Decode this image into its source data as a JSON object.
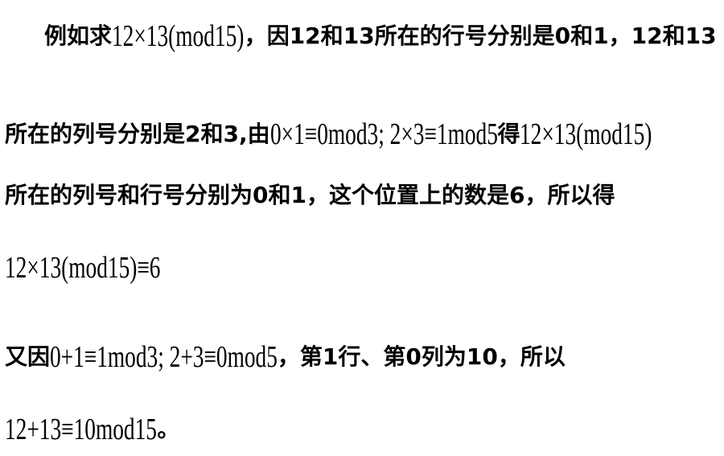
{
  "lines": [
    {
      "id": "l1",
      "segments": [
        {
          "type": "cn",
          "text": "例如求"
        },
        {
          "type": "math",
          "text": "12×13(mod15)"
        },
        {
          "type": "cn",
          "text": "，因 "
        },
        {
          "type": "bold",
          "text": "12"
        },
        {
          "type": "cn",
          "text": " 和 "
        },
        {
          "type": "bold",
          "text": "13"
        },
        {
          "type": "cn",
          "text": " 所在的行号分别是 "
        },
        {
          "type": "bold",
          "text": "0"
        },
        {
          "type": "cn",
          "text": " 和 "
        },
        {
          "type": "bold",
          "text": "1"
        },
        {
          "type": "cn",
          "text": "，"
        },
        {
          "type": "bold",
          "text": "12"
        },
        {
          "type": "cn",
          "text": " 和 "
        },
        {
          "type": "bold",
          "text": "13"
        }
      ]
    },
    {
      "id": "l2",
      "segments": [
        {
          "type": "cn",
          "text": "所在的列号分别是 "
        },
        {
          "type": "bold",
          "text": "2"
        },
        {
          "type": "cn",
          "text": " 和 "
        },
        {
          "type": "bold",
          "text": "3"
        },
        {
          "type": "cn",
          "text": ",由"
        },
        {
          "type": "math",
          "text": "0×1≡0mod3; 2×3≡1mod5"
        },
        {
          "type": "cn",
          "text": "得"
        },
        {
          "type": "math",
          "text": "12×13(mod15)"
        }
      ]
    },
    {
      "id": "l3",
      "segments": [
        {
          "type": "cn",
          "text": "所在的列号和行号分别为 "
        },
        {
          "type": "bold",
          "text": "0"
        },
        {
          "type": "cn",
          "text": " 和 "
        },
        {
          "type": "bold",
          "text": "1"
        },
        {
          "type": "cn",
          "text": "，这个位置上的数是 "
        },
        {
          "type": "bold",
          "text": "6"
        },
        {
          "type": "cn",
          "text": "，所以得"
        }
      ]
    },
    {
      "id": "l4",
      "segments": [
        {
          "type": "math",
          "text": "12×13(mod15)≡6"
        }
      ]
    },
    {
      "id": "l5",
      "segments": [
        {
          "type": "cn",
          "text": "又因 "
        },
        {
          "type": "math",
          "text": "0+1≡1mod3; 2+3≡0mod5"
        },
        {
          "type": "cn",
          "text": " ，第 "
        },
        {
          "type": "bold",
          "text": "1"
        },
        {
          "type": "cn",
          "text": " 行、第 "
        },
        {
          "type": "bold",
          "text": "0"
        },
        {
          "type": "cn",
          "text": " 列为 "
        },
        {
          "type": "bold",
          "text": "10"
        },
        {
          "type": "cn",
          "text": "，所以"
        }
      ]
    },
    {
      "id": "l6",
      "segments": [
        {
          "type": "math",
          "text": "12+13≡10mod15"
        },
        {
          "type": "cn",
          "text": "。"
        }
      ]
    }
  ]
}
